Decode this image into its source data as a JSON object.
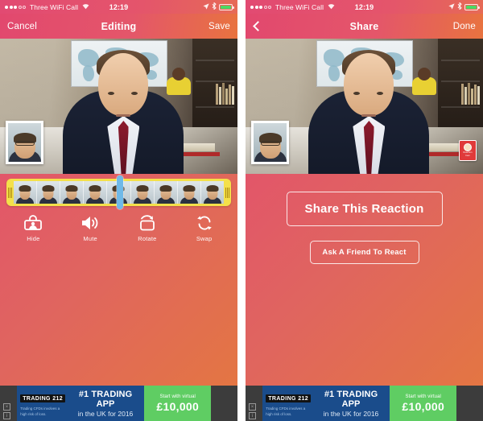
{
  "panels": [
    {
      "id": "editing",
      "statusbar": {
        "carrier": "Three WiFi Call",
        "time": "12:19",
        "wifi_icon": "wifi-icon",
        "location_icon": "location-arrow-icon",
        "bluetooth_icon": "bluetooth-icon",
        "battery_icon": "battery-icon"
      },
      "navbar": {
        "left_label": "Cancel",
        "title": "Editing",
        "right_label": "Save"
      },
      "filmstrip": {
        "frame_count": 9,
        "left_handle": "trim-handle-left",
        "right_handle": "trim-handle-right",
        "playhead": "playhead"
      },
      "tools": [
        {
          "label": "Hide",
          "icon": "hide-icon"
        },
        {
          "label": "Mute",
          "icon": "mute-speaker-icon"
        },
        {
          "label": "Rotate",
          "icon": "rotate-icon"
        },
        {
          "label": "Swap",
          "icon": "swap-icon"
        }
      ]
    },
    {
      "id": "share",
      "statusbar": {
        "carrier": "Three WiFi Call",
        "time": "12:19",
        "wifi_icon": "wifi-icon",
        "location_icon": "location-arrow-icon",
        "bluetooth_icon": "bluetooth-icon",
        "battery_icon": "battery-icon"
      },
      "navbar": {
        "left_label": "",
        "back_icon": "chevron-left-icon",
        "title": "Share",
        "right_label": "Done"
      },
      "buttons": {
        "primary": "Share This Reaction",
        "secondary": "Ask A Friend To React"
      },
      "watermark": {
        "line1": "Reaction",
        "line2": "Cam"
      }
    }
  ],
  "ad": {
    "logo": "TRADING 212",
    "logo_prefix": "TR",
    "logo_sup": "A",
    "logo_suffix": "DING 212",
    "disclaimer": "Trading CFDs involves a high risk of loss.",
    "headline": "#1 TRADING APP",
    "subhead": "in the UK for 2016",
    "cta_small": "Start with virtual",
    "cta_big": "£10,000",
    "close_label": "×",
    "info_label": "i"
  },
  "colors": {
    "gradient_start": "#e0456b",
    "gradient_end": "#e4783f",
    "filmstrip": "#f4e04a",
    "playhead": "#6fb9e8",
    "ad_blue": "#1a4c8b",
    "ad_green": "#5fcd63",
    "battery_green": "#4cd964"
  }
}
